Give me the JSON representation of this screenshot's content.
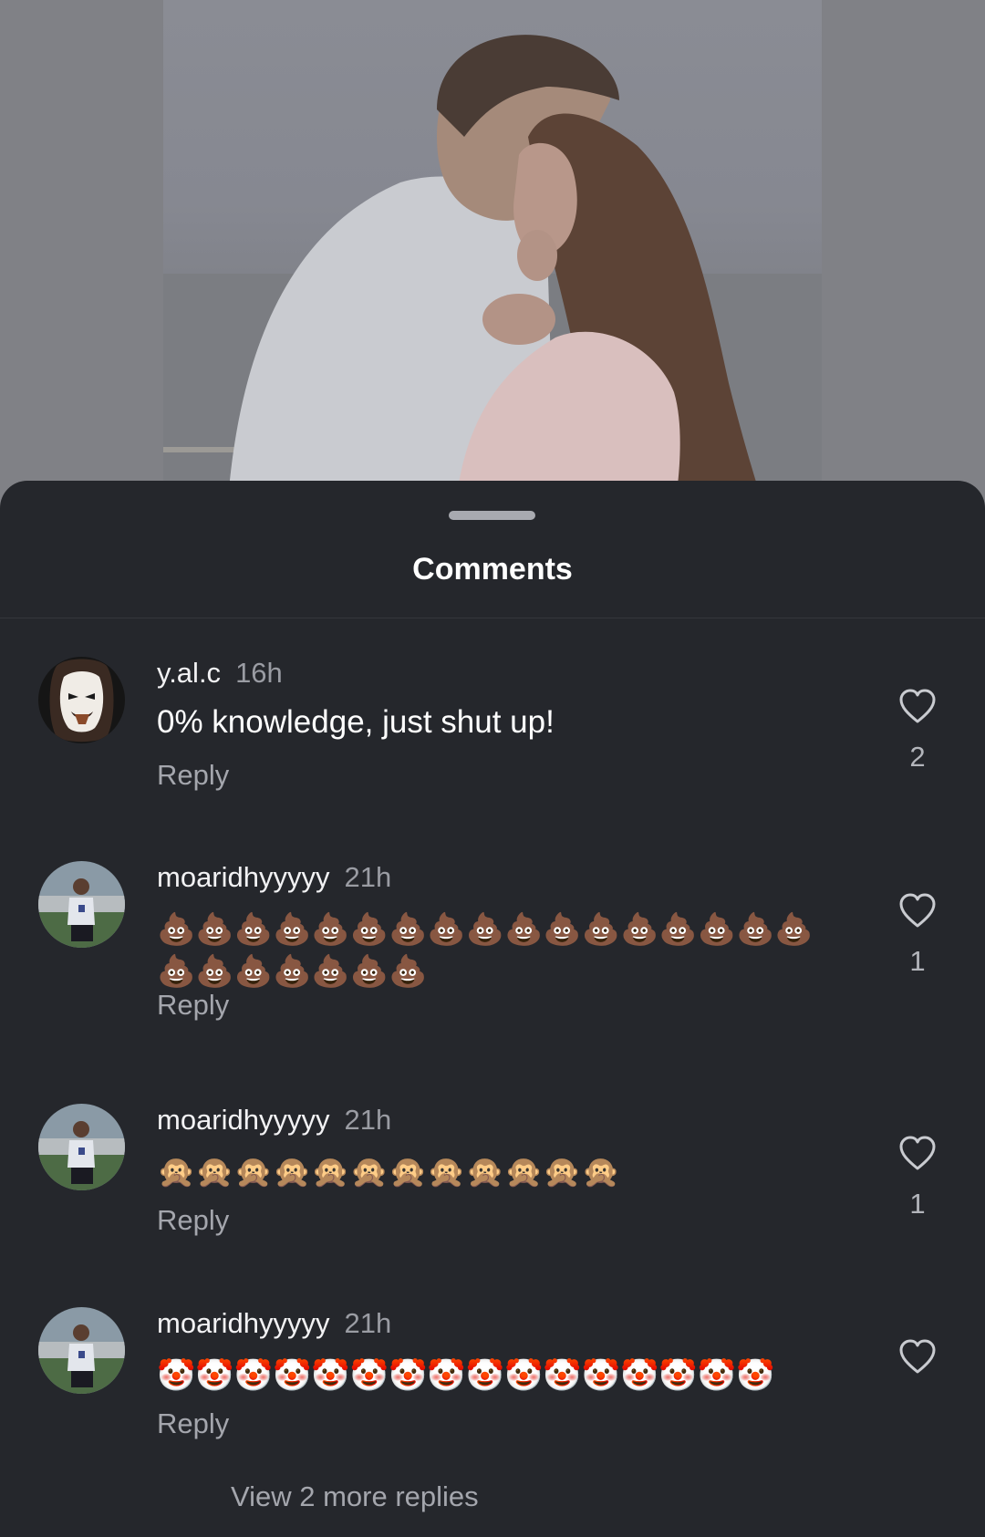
{
  "sheet": {
    "title": "Comments",
    "view_more": "View 2 more replies"
  },
  "comments": [
    {
      "username": "y.al.c",
      "time": "16h",
      "text": "0% knowledge, just shut up!",
      "reply_label": "Reply",
      "likes": "2",
      "avatar": "mask-avatar"
    },
    {
      "username": "moaridhyyyyy",
      "time": "21h",
      "text": "💩💩💩💩💩💩💩💩💩💩💩💩💩💩💩💩💩💩💩💩💩💩💩💩",
      "reply_label": "Reply",
      "likes": "1",
      "avatar": "player-avatar"
    },
    {
      "username": "moaridhyyyyy",
      "time": "21h",
      "text": "🙊🙊🙊🙊🙊🙊🙊🙊🙊🙊🙊🙊",
      "reply_label": "Reply",
      "likes": "1",
      "avatar": "player-avatar"
    },
    {
      "username": "moaridhyyyyy",
      "time": "21h",
      "text": "🤡🤡🤡🤡🤡🤡🤡🤡🤡🤡🤡🤡🤡🤡🤡🤡",
      "reply_label": "Reply",
      "likes": "",
      "avatar": "player-avatar"
    }
  ],
  "icons": {
    "like": "heart-outline-icon",
    "handle": "drag-handle"
  },
  "colors": {
    "sheet_bg": "#25272c",
    "text_primary": "#ffffff",
    "text_secondary": "#a4a6ad"
  }
}
